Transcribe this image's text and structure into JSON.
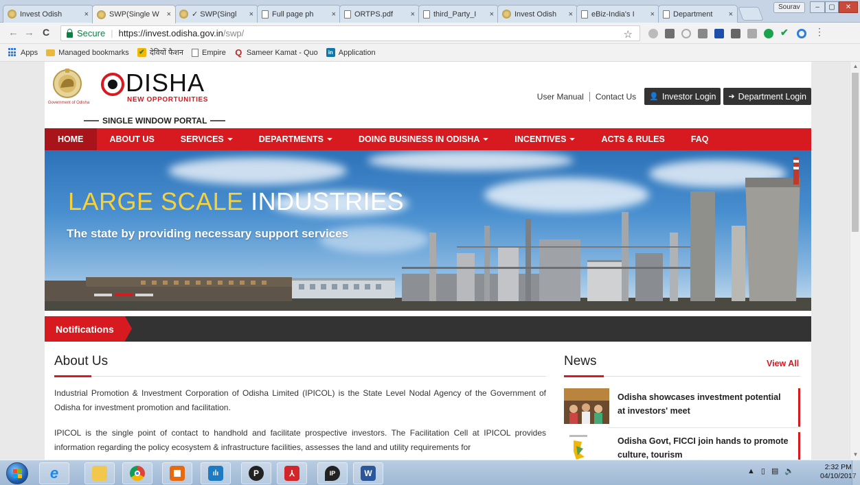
{
  "browser": {
    "tabs": [
      {
        "title": "Invest Odish",
        "icon": "emblem-icon",
        "active": false
      },
      {
        "title": "SWP(Single W",
        "icon": "emblem-icon",
        "active": true
      },
      {
        "title": "✓ SWP(Singl",
        "icon": "emblem-icon",
        "active": false
      },
      {
        "title": "Full page ph",
        "icon": "document-icon",
        "active": false
      },
      {
        "title": "ORTPS.pdf",
        "icon": "document-icon",
        "active": false
      },
      {
        "title": "third_Party_I",
        "icon": "document-icon",
        "active": false
      },
      {
        "title": "Invest Odish",
        "icon": "emblem-icon",
        "active": false
      },
      {
        "title": "eBiz-India's I",
        "icon": "document-icon",
        "active": false
      },
      {
        "title": "Department",
        "icon": "document-icon",
        "active": false
      }
    ],
    "tab_close": "×",
    "profile_name": "Sourav",
    "window_controls": {
      "minimize": "–",
      "maximize": "▢",
      "close": "✕"
    },
    "nav": {
      "back": "←",
      "forward": "→",
      "reload": "C"
    },
    "security_label": "Secure",
    "url_host": "https://invest.odisha.gov.in",
    "url_path": "/swp/",
    "star": "☆",
    "bookmarks": [
      {
        "label": "Apps",
        "icon": "apps-grid-icon"
      },
      {
        "label": "Managed bookmarks",
        "icon": "folder-icon"
      },
      {
        "label": "देवियों फैशन",
        "icon": "bookmark-yellow-icon"
      },
      {
        "label": "Empire",
        "icon": "document-icon"
      },
      {
        "label": "Sameer Kamat - Quo",
        "icon": "quora-icon"
      },
      {
        "label": "Application",
        "icon": "linkedin-icon"
      }
    ]
  },
  "site": {
    "govt_label": "Government of Odisha",
    "brand_name": "DISHA",
    "brand_tagline": "NEW OPPORTUNITIES",
    "portal_name": "SINGLE WINDOW PORTAL",
    "top_links": [
      "User Manual",
      "Contact Us"
    ],
    "investor_login": "Investor Login",
    "department_login": "Department Login",
    "nav": [
      {
        "label": "HOME",
        "dropdown": false,
        "active": true
      },
      {
        "label": "ABOUT US",
        "dropdown": false,
        "active": false
      },
      {
        "label": "SERVICES",
        "dropdown": true,
        "active": false
      },
      {
        "label": "DEPARTMENTS",
        "dropdown": true,
        "active": false
      },
      {
        "label": "DOING BUSINESS IN ODISHA",
        "dropdown": true,
        "active": false
      },
      {
        "label": "INCENTIVES",
        "dropdown": true,
        "active": false
      },
      {
        "label": "ACTS & RULES",
        "dropdown": false,
        "active": false
      },
      {
        "label": "FAQ",
        "dropdown": false,
        "active": false
      }
    ],
    "banner": {
      "title_highlight": "LARGE SCALE",
      "title_rest": "INDUSTRIES",
      "subtitle": "The state by providing necessary support services",
      "slides": 3,
      "active_slide": 1
    },
    "notifications_label": "Notifications",
    "about": {
      "title": "About Us",
      "paragraphs": [
        "Industrial Promotion & Investment Corporation of Odisha Limited (IPICOL) is the State Level Nodal Agency of the Government of Odisha for investment promotion and facilitation.",
        "IPICOL is the single point of contact to handhold and facilitate prospective investors. The Facilitation Cell at IPICOL provides information regarding the policy ecosystem & infrastructure facilities, assesses the land and utility requirements for"
      ]
    },
    "news": {
      "title": "News",
      "view_all": "View All",
      "items": [
        "Odisha showcases investment potential at investors' meet",
        "Odisha Govt, FICCI join hands to promote culture, tourism"
      ]
    }
  },
  "taskbar": {
    "time": "2:32 PM",
    "date": "04/10/2017",
    "tray_expand": "▲"
  },
  "colors": {
    "brand_red": "#d71920",
    "dark_bar": "#333333",
    "secure_green": "#0b8043"
  }
}
